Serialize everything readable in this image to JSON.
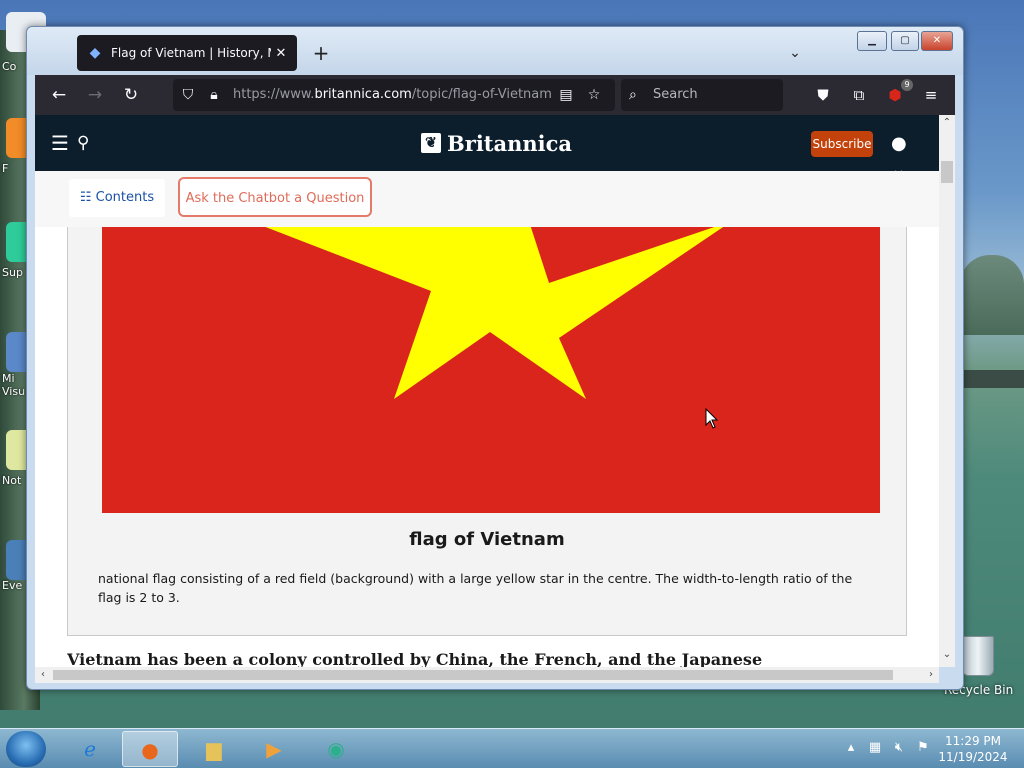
{
  "desktop": {
    "icons": [
      {
        "label": "Co"
      },
      {
        "label": "F"
      },
      {
        "label": "Sup"
      },
      {
        "label": "Mi Visu"
      },
      {
        "label": "Not"
      },
      {
        "label": "Eve"
      }
    ],
    "recycle_bin_label": "Recycle Bin"
  },
  "browser": {
    "tab_title": "Flag of Vietnam | History, Mean",
    "tab_close": "✕",
    "new_tab": "+",
    "url_prefix": "https://www.",
    "url_domain": "britannica.com",
    "url_path": "/topic/flag-of-Vietnam",
    "search_placeholder": "Search",
    "extension_badge": "9"
  },
  "site": {
    "logo_text": "Britannica",
    "subscribe_label": "Subscribe",
    "contents_label": "Contents",
    "chatbot_label": "Ask the Chatbot a Question",
    "figure": {
      "title": "flag of Vietnam",
      "caption": "national flag consisting of a red field (background) with a large yellow star in the centre. The width-to-length ratio of the flag is 2 to 3.",
      "flag_colors": {
        "field": "#da251d",
        "star": "#ffff00"
      }
    },
    "next_paragraph_fragment": "Vietnam has been a colony controlled by China, the French, and the Japanese"
  },
  "taskbar": {
    "apps": [
      "Internet Explorer",
      "Firefox",
      "File Explorer",
      "Media Player",
      "App"
    ],
    "clock_time": "11:29 PM",
    "clock_date": "11/19/2024"
  },
  "colors": {
    "britannica_header": "#0c1d2b",
    "subscribe": "#c3420b",
    "chatbot_border": "#e47a6a",
    "firefox_toolbar": "#2b2a33"
  }
}
